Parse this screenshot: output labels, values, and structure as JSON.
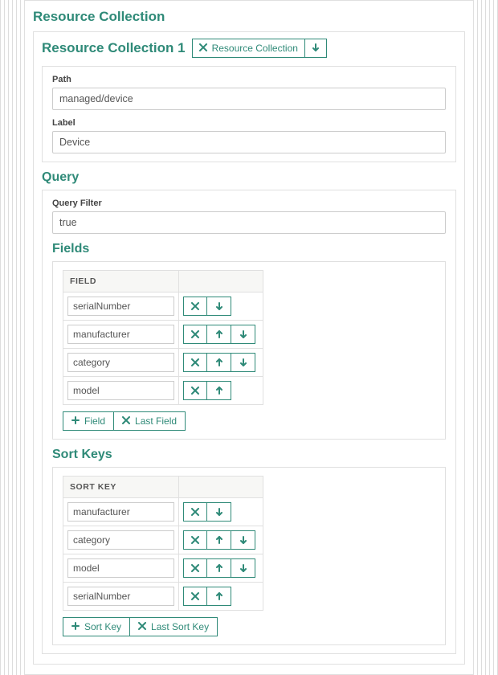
{
  "headings": {
    "resource_collection": "Resource Collection",
    "resource_collection_1": "Resource Collection 1",
    "query": "Query",
    "fields": "Fields",
    "sort_keys": "Sort Keys"
  },
  "resource_collection_remove_label": "Resource Collection",
  "labels": {
    "path": "Path",
    "label": "Label",
    "query_filter": "Query Filter"
  },
  "values": {
    "path": "managed/device",
    "label": "Device",
    "query_filter": "true"
  },
  "columns": {
    "field": "FIELD",
    "sort_key": "SORT KEY"
  },
  "fields": [
    "serialNumber",
    "manufacturer",
    "category",
    "model"
  ],
  "sort_keys": [
    "manufacturer",
    "category",
    "model",
    "serialNumber"
  ],
  "buttons": {
    "add_field": "Field",
    "last_field": "Last Field",
    "add_sort_key": "Sort Key",
    "last_sort_key": "Last Sort Key"
  }
}
